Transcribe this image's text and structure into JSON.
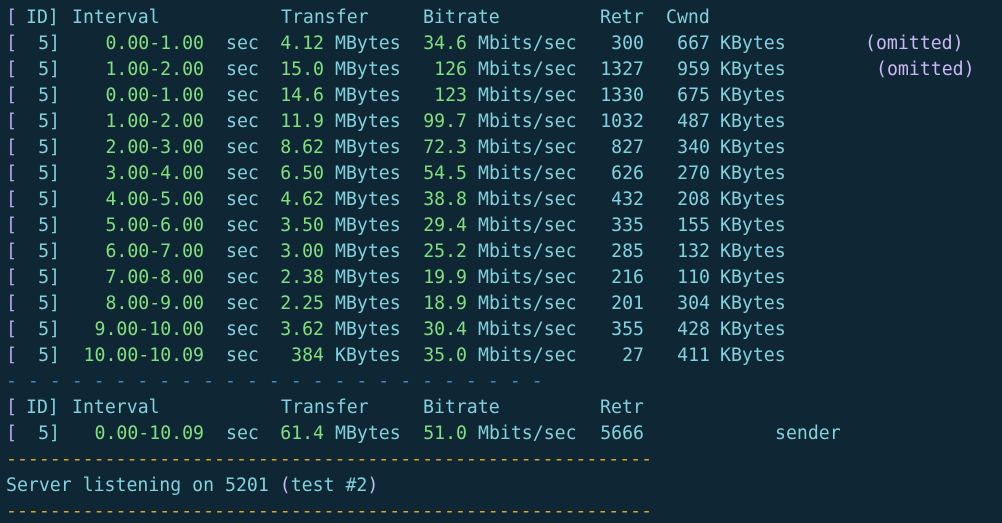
{
  "header": {
    "lbrack": "[",
    "id": "ID]",
    "interval": "Interval",
    "transfer": "Transfer",
    "bitrate": "Bitrate",
    "retr": "Retr",
    "cwnd": "Cwnd"
  },
  "rows": [
    {
      "id": "5]",
      "interval": "0.00-1.00",
      "unit": "sec",
      "transfer": "4.12",
      "tunit": "MBytes",
      "bitrate": "34.6",
      "bunit": "Mbits/sec",
      "retr": "300",
      "cwnd": "667",
      "cunit": "KBytes",
      "note": "(omitted)"
    },
    {
      "id": "5]",
      "interval": "1.00-2.00",
      "unit": "sec",
      "transfer": "15.0",
      "tunit": "MBytes",
      "bitrate": "126",
      "bunit": "Mbits/sec",
      "retr": "1327",
      "cwnd": "959",
      "cunit": "KBytes",
      "note": "(omitted)"
    },
    {
      "id": "5]",
      "interval": "0.00-1.00",
      "unit": "sec",
      "transfer": "14.6",
      "tunit": "MBytes",
      "bitrate": "123",
      "bunit": "Mbits/sec",
      "retr": "1330",
      "cwnd": "675",
      "cunit": "KBytes",
      "note": ""
    },
    {
      "id": "5]",
      "interval": "1.00-2.00",
      "unit": "sec",
      "transfer": "11.9",
      "tunit": "MBytes",
      "bitrate": "99.7",
      "bunit": "Mbits/sec",
      "retr": "1032",
      "cwnd": "487",
      "cunit": "KBytes",
      "note": ""
    },
    {
      "id": "5]",
      "interval": "2.00-3.00",
      "unit": "sec",
      "transfer": "8.62",
      "tunit": "MBytes",
      "bitrate": "72.3",
      "bunit": "Mbits/sec",
      "retr": "827",
      "cwnd": "340",
      "cunit": "KBytes",
      "note": ""
    },
    {
      "id": "5]",
      "interval": "3.00-4.00",
      "unit": "sec",
      "transfer": "6.50",
      "tunit": "MBytes",
      "bitrate": "54.5",
      "bunit": "Mbits/sec",
      "retr": "626",
      "cwnd": "270",
      "cunit": "KBytes",
      "note": ""
    },
    {
      "id": "5]",
      "interval": "4.00-5.00",
      "unit": "sec",
      "transfer": "4.62",
      "tunit": "MBytes",
      "bitrate": "38.8",
      "bunit": "Mbits/sec",
      "retr": "432",
      "cwnd": "208",
      "cunit": "KBytes",
      "note": ""
    },
    {
      "id": "5]",
      "interval": "5.00-6.00",
      "unit": "sec",
      "transfer": "3.50",
      "tunit": "MBytes",
      "bitrate": "29.4",
      "bunit": "Mbits/sec",
      "retr": "335",
      "cwnd": "155",
      "cunit": "KBytes",
      "note": ""
    },
    {
      "id": "5]",
      "interval": "6.00-7.00",
      "unit": "sec",
      "transfer": "3.00",
      "tunit": "MBytes",
      "bitrate": "25.2",
      "bunit": "Mbits/sec",
      "retr": "285",
      "cwnd": "132",
      "cunit": "KBytes",
      "note": ""
    },
    {
      "id": "5]",
      "interval": "7.00-8.00",
      "unit": "sec",
      "transfer": "2.38",
      "tunit": "MBytes",
      "bitrate": "19.9",
      "bunit": "Mbits/sec",
      "retr": "216",
      "cwnd": "110",
      "cunit": "KBytes",
      "note": ""
    },
    {
      "id": "5]",
      "interval": "8.00-9.00",
      "unit": "sec",
      "transfer": "2.25",
      "tunit": "MBytes",
      "bitrate": "18.9",
      "bunit": "Mbits/sec",
      "retr": "201",
      "cwnd": "304",
      "cunit": "KBytes",
      "note": ""
    },
    {
      "id": "5]",
      "interval": "9.00-10.00",
      "unit": "sec",
      "transfer": "3.62",
      "tunit": "MBytes",
      "bitrate": "30.4",
      "bunit": "Mbits/sec",
      "retr": "355",
      "cwnd": "428",
      "cunit": "KBytes",
      "note": ""
    },
    {
      "id": "5]",
      "interval": "10.00-10.09",
      "unit": "sec",
      "transfer": "384",
      "tunit": "KBytes",
      "bitrate": "35.0",
      "bunit": "Mbits/sec",
      "retr": "27",
      "cwnd": "411",
      "cunit": "KBytes",
      "note": ""
    }
  ],
  "separator_blue": "- - - - - - - - - - - - - - - - - - - - - - - - -",
  "summary_header": {
    "lbrack": "[",
    "id": "ID]",
    "interval": "Interval",
    "transfer": "Transfer",
    "bitrate": "Bitrate",
    "retr": "Retr"
  },
  "summary": {
    "id": "5]",
    "interval": "0.00-10.09",
    "unit": "sec",
    "transfer": "61.4",
    "tunit": "MBytes",
    "bitrate": "51.0",
    "bunit": "Mbits/sec",
    "retr": "5666",
    "role": "sender"
  },
  "separator_orange": "-----------------------------------------------------------",
  "server_msg": {
    "text": "Server listening on 5201 ",
    "paren_open": "(",
    "test": "test #2",
    "paren_close": ")"
  },
  "colors": {
    "background": "#0f2634",
    "cyan": "#7fd3df",
    "green": "#7ee07e",
    "purple": "#c9b8f5",
    "blue_dash": "#4a86c0",
    "orange_dash": "#e0a62a"
  }
}
